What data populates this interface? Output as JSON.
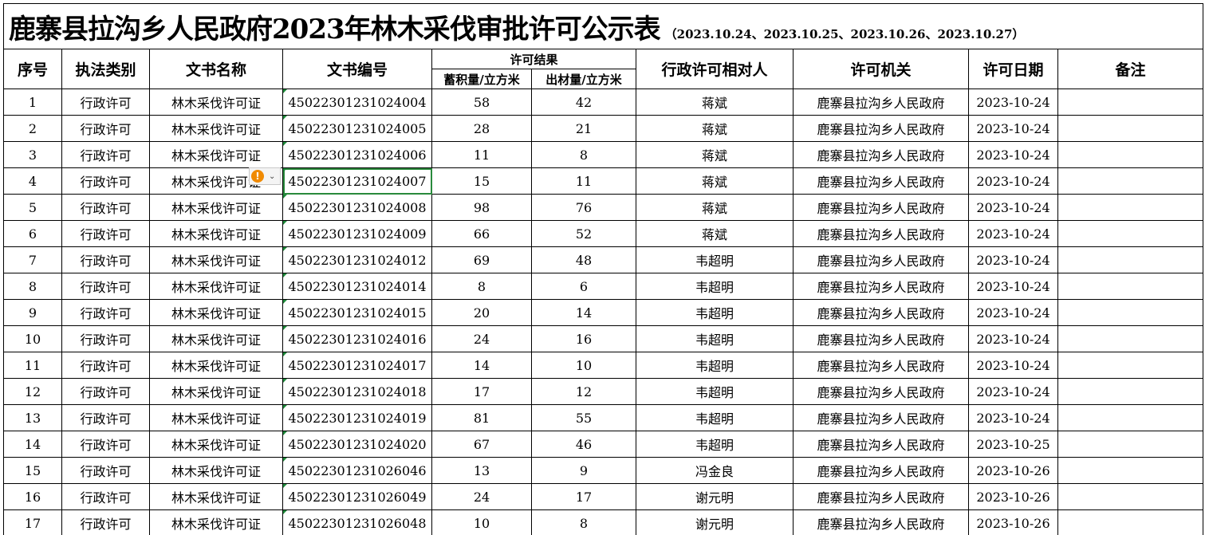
{
  "title": {
    "main": "鹿寨县拉沟乡人民政府2023年林木采伐审批许可公示表",
    "dates": "（2023.10.24、2023.10.25、2023.10.26、2023.10.27）"
  },
  "headers": {
    "index": "序号",
    "enforcement_type": "执法类别",
    "document_name": "文书名称",
    "document_number": "文书编号",
    "permit_result": "许可结果",
    "stock_volume": "蓄积量/立方米",
    "output_volume": "出材量/立方米",
    "counterpart": "行政许可相对人",
    "authority": "许可机关",
    "permit_date": "许可日期",
    "remarks": "备注"
  },
  "rows": [
    {
      "index": "1",
      "type": "行政许可",
      "doc": "林木采伐许可证",
      "number": "45022301231024004",
      "stock": "58",
      "output": "42",
      "person": "蒋斌",
      "authority": "鹿寨县拉沟乡人民政府",
      "date": "2023-10-24",
      "remark": ""
    },
    {
      "index": "2",
      "type": "行政许可",
      "doc": "林木采伐许可证",
      "number": "45022301231024005",
      "stock": "28",
      "output": "21",
      "person": "蒋斌",
      "authority": "鹿寨县拉沟乡人民政府",
      "date": "2023-10-24",
      "remark": ""
    },
    {
      "index": "3",
      "type": "行政许可",
      "doc": "林木采伐许可证",
      "number": "45022301231024006",
      "stock": "11",
      "output": "8",
      "person": "蒋斌",
      "authority": "鹿寨县拉沟乡人民政府",
      "date": "2023-10-24",
      "remark": ""
    },
    {
      "index": "4",
      "type": "行政许可",
      "doc": "林木采伐许可证",
      "number": "45022301231024007",
      "stock": "15",
      "output": "11",
      "person": "蒋斌",
      "authority": "鹿寨县拉沟乡人民政府",
      "date": "2023-10-24",
      "remark": ""
    },
    {
      "index": "5",
      "type": "行政许可",
      "doc": "林木采伐许可证",
      "number": "45022301231024008",
      "stock": "98",
      "output": "76",
      "person": "蒋斌",
      "authority": "鹿寨县拉沟乡人民政府",
      "date": "2023-10-24",
      "remark": ""
    },
    {
      "index": "6",
      "type": "行政许可",
      "doc": "林木采伐许可证",
      "number": "45022301231024009",
      "stock": "66",
      "output": "52",
      "person": "蒋斌",
      "authority": "鹿寨县拉沟乡人民政府",
      "date": "2023-10-24",
      "remark": ""
    },
    {
      "index": "7",
      "type": "行政许可",
      "doc": "林木采伐许可证",
      "number": "45022301231024012",
      "stock": "69",
      "output": "48",
      "person": "韦超明",
      "authority": "鹿寨县拉沟乡人民政府",
      "date": "2023-10-24",
      "remark": ""
    },
    {
      "index": "8",
      "type": "行政许可",
      "doc": "林木采伐许可证",
      "number": "45022301231024014",
      "stock": "8",
      "output": "6",
      "person": "韦超明",
      "authority": "鹿寨县拉沟乡人民政府",
      "date": "2023-10-24",
      "remark": ""
    },
    {
      "index": "9",
      "type": "行政许可",
      "doc": "林木采伐许可证",
      "number": "45022301231024015",
      "stock": "20",
      "output": "14",
      "person": "韦超明",
      "authority": "鹿寨县拉沟乡人民政府",
      "date": "2023-10-24",
      "remark": ""
    },
    {
      "index": "10",
      "type": "行政许可",
      "doc": "林木采伐许可证",
      "number": "45022301231024016",
      "stock": "24",
      "output": "16",
      "person": "韦超明",
      "authority": "鹿寨县拉沟乡人民政府",
      "date": "2023-10-24",
      "remark": ""
    },
    {
      "index": "11",
      "type": "行政许可",
      "doc": "林木采伐许可证",
      "number": "45022301231024017",
      "stock": "14",
      "output": "10",
      "person": "韦超明",
      "authority": "鹿寨县拉沟乡人民政府",
      "date": "2023-10-24",
      "remark": ""
    },
    {
      "index": "12",
      "type": "行政许可",
      "doc": "林木采伐许可证",
      "number": "45022301231024018",
      "stock": "17",
      "output": "12",
      "person": "韦超明",
      "authority": "鹿寨县拉沟乡人民政府",
      "date": "2023-10-24",
      "remark": ""
    },
    {
      "index": "13",
      "type": "行政许可",
      "doc": "林木采伐许可证",
      "number": "45022301231024019",
      "stock": "81",
      "output": "55",
      "person": "韦超明",
      "authority": "鹿寨县拉沟乡人民政府",
      "date": "2023-10-24",
      "remark": ""
    },
    {
      "index": "14",
      "type": "行政许可",
      "doc": "林木采伐许可证",
      "number": "45022301231024020",
      "stock": "67",
      "output": "46",
      "person": "韦超明",
      "authority": "鹿寨县拉沟乡人民政府",
      "date": "2023-10-25",
      "remark": ""
    },
    {
      "index": "15",
      "type": "行政许可",
      "doc": "林木采伐许可证",
      "number": "45022301231026046",
      "stock": "13",
      "output": "9",
      "person": "冯金良",
      "authority": "鹿寨县拉沟乡人民政府",
      "date": "2023-10-26",
      "remark": ""
    },
    {
      "index": "16",
      "type": "行政许可",
      "doc": "林木采伐许可证",
      "number": "45022301231026049",
      "stock": "24",
      "output": "17",
      "person": "谢元明",
      "authority": "鹿寨县拉沟乡人民政府",
      "date": "2023-10-26",
      "remark": ""
    },
    {
      "index": "17",
      "type": "行政许可",
      "doc": "林木采伐许可证",
      "number": "45022301231026048",
      "stock": "10",
      "output": "8",
      "person": "谢元明",
      "authority": "鹿寨县拉沟乡人民政府",
      "date": "2023-10-26",
      "remark": ""
    }
  ],
  "selection": {
    "row": 4,
    "column": "number"
  },
  "icons": {
    "warning": "warning-icon",
    "dropdown": "chevron-down-icon"
  },
  "colors": {
    "grid": "#000000",
    "selection": "#2a8a3c",
    "note_marker": "#1e8a3a",
    "warning": "#f08a00"
  }
}
